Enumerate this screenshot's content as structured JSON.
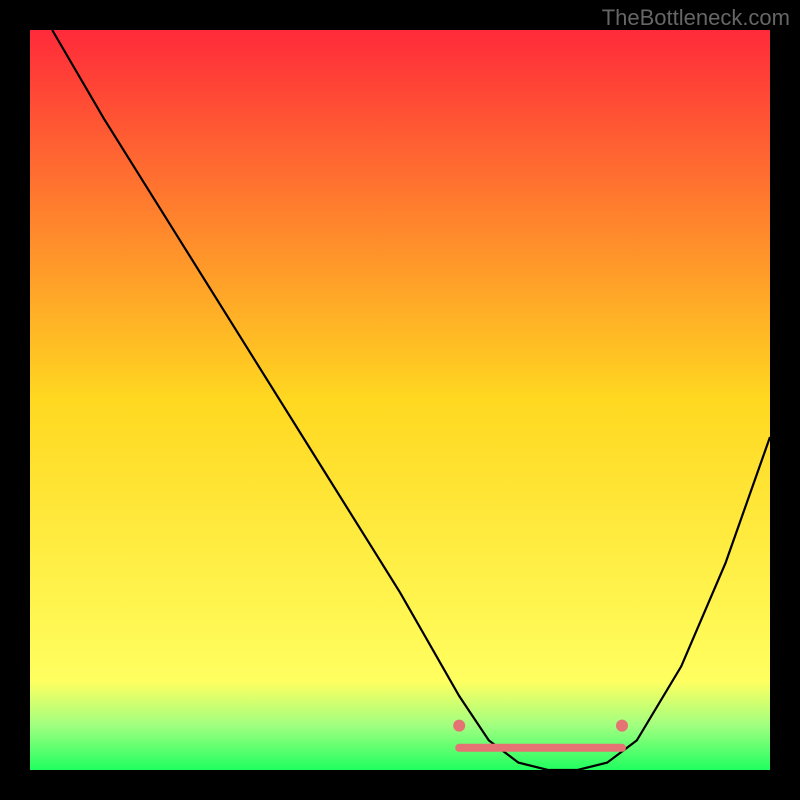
{
  "watermark": "TheBottleneck.com",
  "chart_data": {
    "type": "line",
    "title": "",
    "xlabel": "",
    "ylabel": "",
    "xlim": [
      0,
      100
    ],
    "ylim": [
      0,
      100
    ],
    "background_gradient": {
      "stops": [
        {
          "offset": 0,
          "color": "#ff2a3a"
        },
        {
          "offset": 50,
          "color": "#ffd820"
        },
        {
          "offset": 88,
          "color": "#ffff60"
        },
        {
          "offset": 94,
          "color": "#a0ff80"
        },
        {
          "offset": 100,
          "color": "#20ff60"
        }
      ]
    },
    "series": [
      {
        "name": "bottleneck-curve",
        "color": "#000000",
        "x": [
          3,
          10,
          20,
          30,
          40,
          50,
          58,
          62,
          66,
          70,
          74,
          78,
          82,
          88,
          94,
          100
        ],
        "y": [
          100,
          88,
          72,
          56,
          40,
          24,
          10,
          4,
          1,
          0,
          0,
          1,
          4,
          14,
          28,
          45
        ]
      }
    ],
    "marker_band": {
      "color": "#e57373",
      "x_start": 58,
      "x_end": 80,
      "y_level": 3,
      "dots": [
        {
          "x": 58,
          "y": 6
        },
        {
          "x": 80,
          "y": 6
        }
      ]
    }
  }
}
